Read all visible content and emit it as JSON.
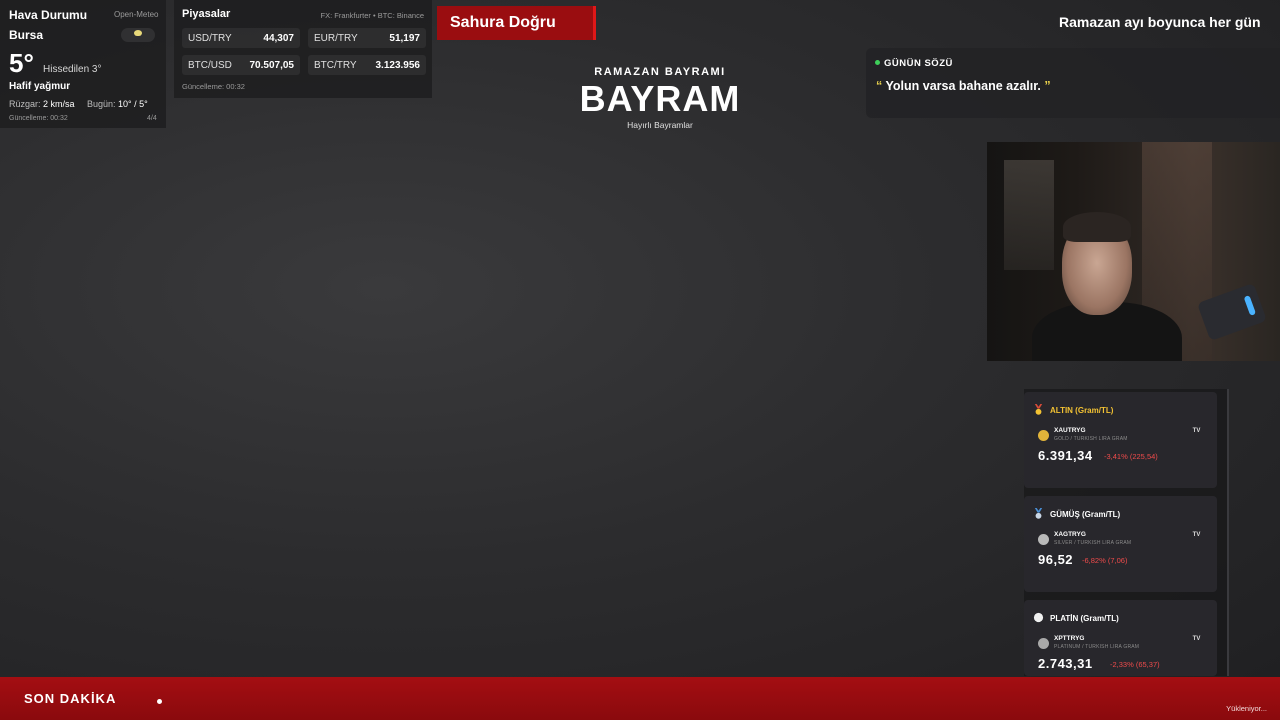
{
  "weather": {
    "title": "Hava Durumu",
    "source": "Open-Meteo",
    "city": "Bursa",
    "icon": "partly-cloudy-icon",
    "temperature": "5°",
    "feels_like": "Hissedilen 3°",
    "condition": "Hafif yağmur",
    "wind_label": "Rüzgar:",
    "wind_value": "2 km/sa",
    "today_label": "Bugün:",
    "today_value": "10° / 5°",
    "updated": "Güncelleme: 00:32",
    "page": "4/4"
  },
  "markets": {
    "title": "Piyasalar",
    "source": "FX: Frankfurter • BTC: Binance",
    "rates": [
      {
        "label": "USD/TRY",
        "value": "44,307"
      },
      {
        "label": "EUR/TRY",
        "value": "51,197"
      },
      {
        "label": "BTC/USD",
        "value": "70.507,05"
      },
      {
        "label": "BTC/TRY",
        "value": "3.123.956"
      }
    ],
    "updated": "Güncelleme: 00:32"
  },
  "sahur": {
    "label": "Sahura Doğru",
    "accent": "#9a0d10"
  },
  "top_ticker": "Ramazan ayı boyunca her gün",
  "bayram": {
    "subtitle": "RAMAZAN BAYRAMI",
    "title": "BAYRAM",
    "wish": "Hayırlı Bayramlar"
  },
  "quote": {
    "heading": "GÜNÜN SÖZÜ",
    "open_mark": "“",
    "text": "Yolun varsa bahane azalır.",
    "close_mark": "”"
  },
  "commodities": [
    {
      "title": "ALTIN (Gram/TL)",
      "symbol": "XAUTRYG",
      "description": "GOLD / TURKISH LIRA GRAM",
      "price": "6.391,34",
      "change": "-3,41% (225,54)",
      "medal_color": "#f3c233",
      "coin_color": "#e2b43a",
      "title_gold": true
    },
    {
      "title": "GÜMÜŞ (Gram/TL)",
      "symbol": "XAGTRYG",
      "description": "SILVER / TURKISH LIRA GRAM",
      "price": "96,52",
      "change": "-6,82% (7,06)",
      "medal_color": "#9fb8d8",
      "coin_color": "#b9b9b9",
      "title_gold": false
    },
    {
      "title": "PLATİN (Gram/TL)",
      "symbol": "XPTTRYG",
      "description": "PLATINUM / TURKISH LIRA GRAM",
      "price": "2.743,31",
      "change": "-2,33% (65,37)",
      "medal_color": "#f0f0f0",
      "coin_color": "#a9a9a9",
      "title_gold": false
    }
  ],
  "tv_label": "TV",
  "bottom": {
    "label": "SON DAKİKA",
    "loading": "Yükleniyor..."
  }
}
